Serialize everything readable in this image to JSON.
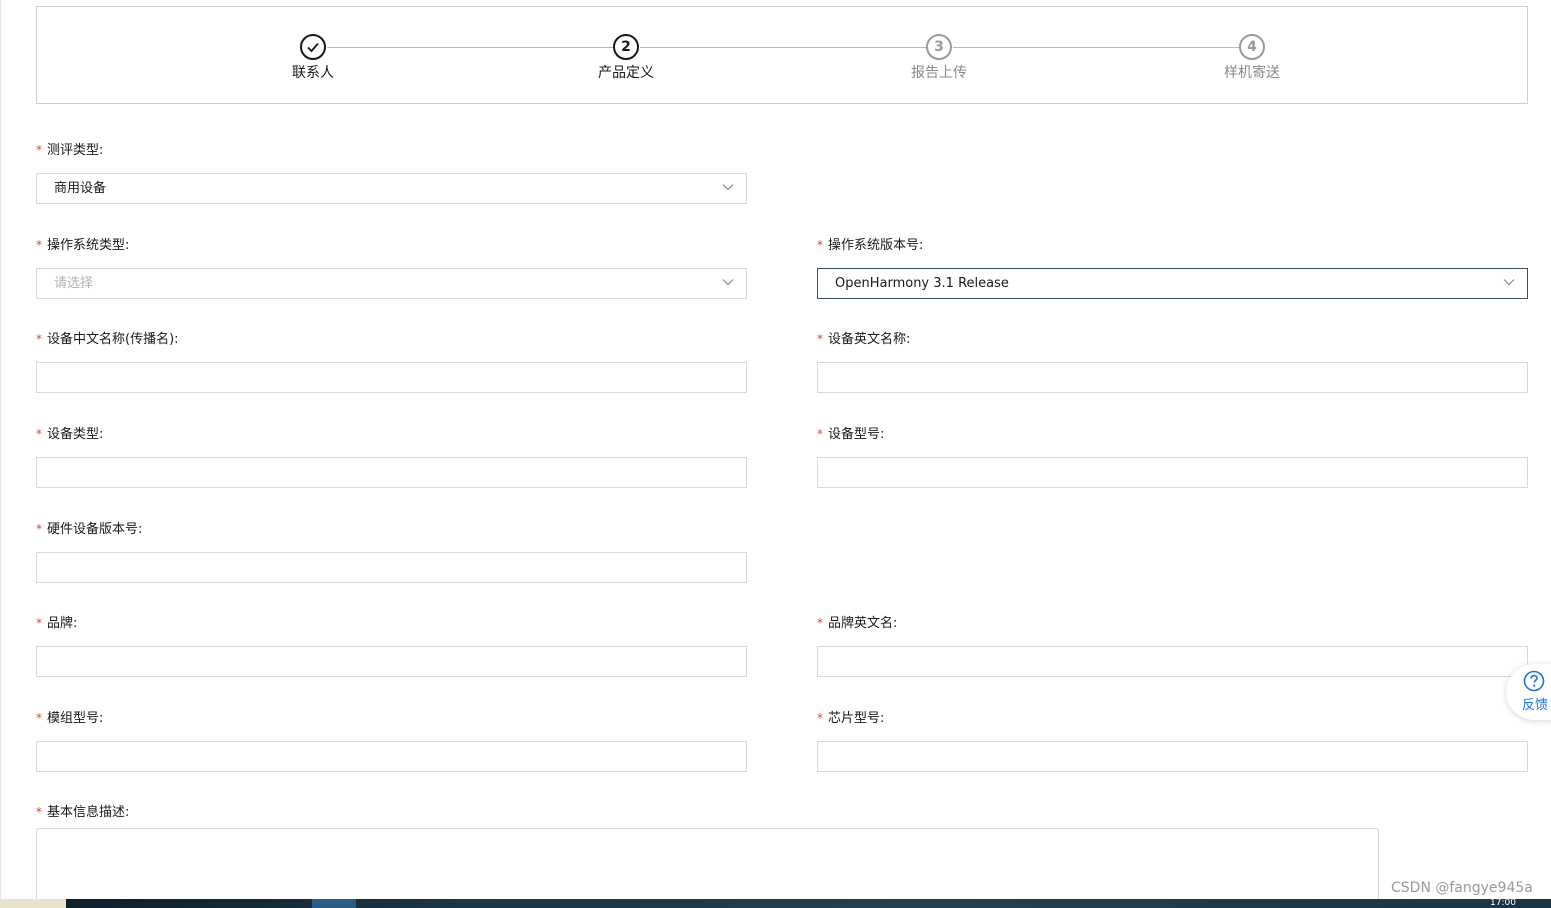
{
  "steps": [
    {
      "label": "联系人",
      "marker": "",
      "status": "done"
    },
    {
      "label": "产品定义",
      "marker": "2",
      "status": "current"
    },
    {
      "label": "报告上传",
      "marker": "3",
      "status": "todo"
    },
    {
      "label": "样机寄送",
      "marker": "4",
      "status": "todo"
    }
  ],
  "form": {
    "required_mark": "*",
    "eval_type": {
      "label": "测评类型:",
      "value": "商用设备"
    },
    "os_type": {
      "label": "操作系统类型:",
      "placeholder": "请选择"
    },
    "os_version": {
      "label": "操作系统版本号:",
      "value": "OpenHarmony 3.1 Release"
    },
    "device_cn_name": {
      "label": "设备中文名称(传播名):"
    },
    "device_en_name": {
      "label": "设备英文名称:"
    },
    "device_type": {
      "label": "设备类型:"
    },
    "device_model": {
      "label": "设备型号:"
    },
    "hardware_version": {
      "label": "硬件设备版本号:"
    },
    "brand": {
      "label": "品牌:"
    },
    "brand_en": {
      "label": "品牌英文名:"
    },
    "module_model": {
      "label": "模组型号:"
    },
    "chip_model": {
      "label": "芯片型号:"
    },
    "basic_info": {
      "label": "基本信息描述:"
    }
  },
  "feedback": {
    "label": "反馈",
    "icon": "question-circle-icon"
  },
  "watermark": "CSDN @fangye945a",
  "taskbar": {
    "clock": "17:00"
  },
  "colors": {
    "required": "#e5403a",
    "link": "#1a73e8",
    "active_border": "#3b4f66"
  }
}
